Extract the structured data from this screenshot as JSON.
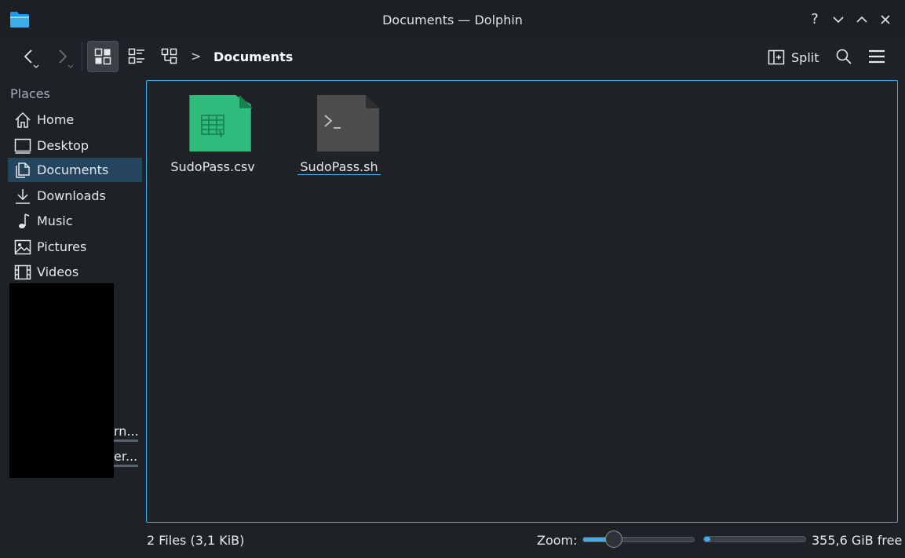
{
  "window": {
    "title": "Documents — Dolphin",
    "controls": [
      "?",
      "⌄",
      "⌃",
      "✕"
    ]
  },
  "toolbar": {
    "back_icon": "chevron-left-icon",
    "forward_icon": "chevron-right-icon",
    "view_modes": [
      "icons-view",
      "details-view",
      "compact-view"
    ],
    "active_view": "icons-view",
    "breadcrumb_separator": ">",
    "breadcrumb": "Documents",
    "split_label": "Split",
    "search_icon": "search-icon",
    "menu_icon": "hamburger-menu-icon"
  },
  "sidebar": {
    "heading": "Places",
    "items": [
      {
        "label": "Home",
        "icon": "home-icon"
      },
      {
        "label": "Desktop",
        "icon": "desktop-icon"
      },
      {
        "label": "Documents",
        "icon": "documents-icon",
        "selected": true
      },
      {
        "label": "Downloads",
        "icon": "downloads-icon"
      },
      {
        "label": "Music",
        "icon": "music-icon"
      },
      {
        "label": "Pictures",
        "icon": "pictures-icon"
      },
      {
        "label": "Videos",
        "icon": "videos-icon"
      }
    ],
    "truncated_items": [
      "rn...",
      "er..."
    ]
  },
  "files": [
    {
      "name": "SudoPass.csv",
      "icon": "spreadsheet-file-icon",
      "color": "#2ebc7c"
    },
    {
      "name": "SudoPass.sh",
      "icon": "shell-script-file-icon",
      "color": "#4d4d4d"
    }
  ],
  "status": {
    "summary": "2 Files (3,1 KiB)",
    "zoom_label": "Zoom:",
    "zoom_level": 0.28,
    "free_space": "355,6 GiB free",
    "used_fraction": 0.03
  },
  "colors": {
    "accent": "#3daee9",
    "background": "#1f2327",
    "selection": "#25455e"
  }
}
